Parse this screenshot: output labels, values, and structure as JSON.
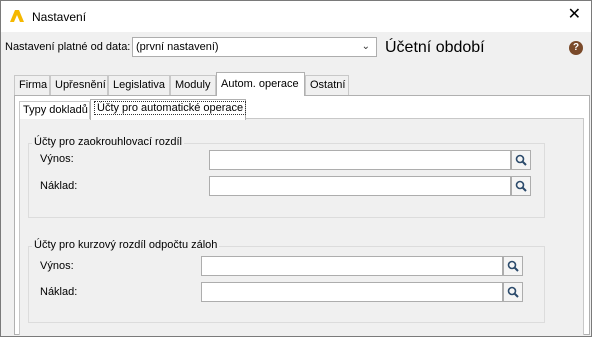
{
  "window": {
    "title": "Nastavení",
    "close_icon": "close-icon"
  },
  "header": {
    "period_label": "Nastavení platné od data:",
    "period_value": "(první nastavení)",
    "heading": "Účetní období",
    "help_label": "?"
  },
  "tabs": [
    {
      "label": "Firma"
    },
    {
      "label": "Upřesnění"
    },
    {
      "label": "Legislativa"
    },
    {
      "label": "Moduly"
    },
    {
      "label": "Autom. operace"
    },
    {
      "label": "Ostatní"
    }
  ],
  "subtabs": [
    {
      "label": "Typy dokladů"
    },
    {
      "label": "Účty pro automatické operace"
    }
  ],
  "groups": [
    {
      "title": "Účty pro zaokrouhlovací rozdíl",
      "income_label": "Výnos:",
      "expense_label": "Náklad:",
      "income_value": "",
      "expense_value": ""
    },
    {
      "title": "Účty pro kurzový rozdíl odpočtu záloh",
      "income_label": "Výnos:",
      "expense_label": "Náklad:",
      "income_value": "",
      "expense_value": ""
    }
  ],
  "colors": {
    "logo": "#f5b800",
    "help": "#7a4a2a",
    "search_icon": "#2b4a6b"
  }
}
